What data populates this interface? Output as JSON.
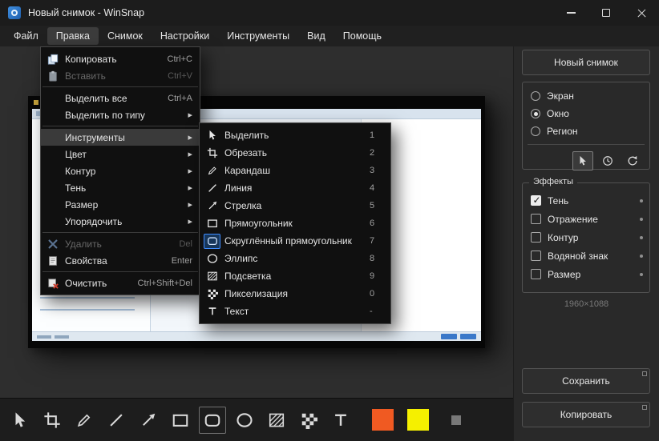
{
  "window": {
    "title": "Новый снимок - WinSnap"
  },
  "menubar": {
    "items": [
      {
        "label": "Файл"
      },
      {
        "label": "Правка",
        "open": true
      },
      {
        "label": "Снимок"
      },
      {
        "label": "Настройки"
      },
      {
        "label": "Инструменты"
      },
      {
        "label": "Вид"
      },
      {
        "label": "Помощь"
      }
    ]
  },
  "edit_menu": {
    "items": [
      {
        "label": "Копировать",
        "shortcut": "Ctrl+C",
        "icon": "copy-icon"
      },
      {
        "label": "Вставить",
        "shortcut": "Ctrl+V",
        "icon": "paste-icon",
        "disabled": true
      },
      {
        "type": "separator"
      },
      {
        "label": "Выделить все",
        "shortcut": "Ctrl+A"
      },
      {
        "label": "Выделить по типу",
        "submenu": true
      },
      {
        "type": "separator"
      },
      {
        "label": "Инструменты",
        "submenu": true,
        "highlighted": true
      },
      {
        "label": "Цвет",
        "submenu": true
      },
      {
        "label": "Контур",
        "submenu": true
      },
      {
        "label": "Тень",
        "submenu": true
      },
      {
        "label": "Размер",
        "submenu": true
      },
      {
        "label": "Упорядочить",
        "submenu": true
      },
      {
        "type": "separator"
      },
      {
        "label": "Удалить",
        "shortcut": "Del",
        "icon": "delete-icon",
        "disabled": true
      },
      {
        "label": "Свойства",
        "shortcut": "Enter",
        "icon": "properties-icon"
      },
      {
        "type": "separator"
      },
      {
        "label": "Очистить",
        "shortcut": "Ctrl+Shift+Del",
        "icon": "clear-icon"
      }
    ]
  },
  "tools_submenu": {
    "items": [
      {
        "label": "Выделить",
        "key": "1",
        "icon": "select-icon"
      },
      {
        "label": "Обрезать",
        "key": "2",
        "icon": "crop-icon"
      },
      {
        "label": "Карандаш",
        "key": "3",
        "icon": "pencil-icon"
      },
      {
        "label": "Линия",
        "key": "4",
        "icon": "line-icon"
      },
      {
        "label": "Стрелка",
        "key": "5",
        "icon": "arrow-icon"
      },
      {
        "label": "Прямоугольник",
        "key": "6",
        "icon": "rectangle-icon"
      },
      {
        "label": "Скруглённый прямоугольник",
        "key": "7",
        "icon": "rounded-rectangle-icon",
        "selected": true
      },
      {
        "label": "Эллипс",
        "key": "8",
        "icon": "ellipse-icon"
      },
      {
        "label": "Подсветка",
        "key": "9",
        "icon": "highlight-icon"
      },
      {
        "label": "Пикселизация",
        "key": "0",
        "icon": "pixelate-icon"
      },
      {
        "label": "Текст",
        "key": "-",
        "icon": "text-icon"
      }
    ]
  },
  "sidebar": {
    "new_snapshot_button": "Новый снимок",
    "capture_modes": [
      {
        "label": "Экран",
        "selected": false
      },
      {
        "label": "Окно",
        "selected": true
      },
      {
        "label": "Регион",
        "selected": false
      }
    ],
    "capture_buttons": [
      "select-icon",
      "clock-icon",
      "refresh-icon"
    ],
    "effects_group_title": "Эффекты",
    "effects": [
      {
        "label": "Тень",
        "checked": true
      },
      {
        "label": "Отражение",
        "checked": false
      },
      {
        "label": "Контур",
        "checked": false
      },
      {
        "label": "Водяной знак",
        "checked": false
      },
      {
        "label": "Размер",
        "checked": false
      }
    ],
    "resolution": "1960×1088",
    "save_button": "Сохранить",
    "copy_button": "Копировать"
  },
  "bottom_toolbar": {
    "tools": [
      "select",
      "crop",
      "pencil",
      "line",
      "arrow",
      "rectangle",
      "rounded-rectangle",
      "ellipse",
      "highlight",
      "pixelate",
      "text"
    ],
    "selected_tool": "rounded-rectangle",
    "primary_color": "#f05a22",
    "secondary_color": "#f5f000"
  }
}
